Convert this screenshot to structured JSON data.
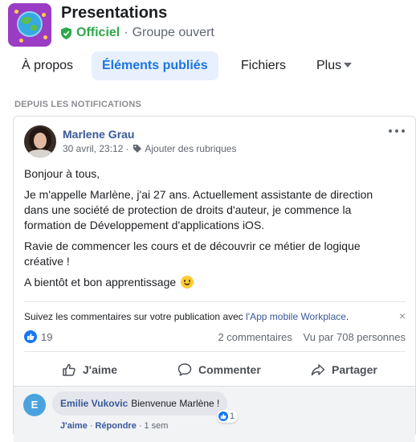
{
  "group": {
    "title": "Presentations",
    "badge": "Officiel",
    "privacy": "Groupe ouvert",
    "separator": "·"
  },
  "tabs": [
    {
      "label": "À propos",
      "active": false
    },
    {
      "label": "Éléments publiés",
      "active": true
    },
    {
      "label": "Fichiers",
      "active": false
    },
    {
      "label": "Plus",
      "active": false
    }
  ],
  "section_label": "DEPUIS LES NOTIFICATIONS",
  "post": {
    "author": "Marlene Grau",
    "date": "30 avril, 23:12",
    "meta_separator": "·",
    "tag_label": "Ajouter des rubriques",
    "body": {
      "p1": "Bonjour à tous,",
      "p2": "Je m'appelle Marlène, j'ai 27 ans. Actuellement assistante de direction dans une société de protection de droits d'auteur, je commence la formation de Développement d'applications iOS.",
      "p3": "Ravie de commencer les cours et de découvrir ce métier de logique créative !",
      "p4": "A bientôt et bon apprentissage"
    },
    "notice_text": "Suivez les commentaires sur votre publication avec ",
    "notice_link": "l'App mobile Workplace",
    "notice_end": ".",
    "notice_close": "×",
    "like_count": "19",
    "comment_count": "2 commentaires",
    "view_count": "Vu par 708 personnes",
    "actions": {
      "like": "J'aime",
      "comment": "Commenter",
      "share": "Partager"
    }
  },
  "comment": {
    "avatar_letter": "E",
    "author": "Emilie Vukovic",
    "text": "Bienvenue Marlène !",
    "reaction_count": "1",
    "like_label": "J'aime",
    "reply_label": "Répondre",
    "separator": "·",
    "time": "1 sem"
  },
  "colors": {
    "accent": "#1b74e4",
    "official_green": "#2ea84a",
    "link": "#385898",
    "group_logo_bg": "#9b3cc4"
  },
  "icons": [
    "shield-icon",
    "caret-down-icon",
    "tag-icon",
    "more-icon",
    "like-icon",
    "comment-icon",
    "share-icon",
    "close-icon",
    "smile-emoji-icon"
  ]
}
